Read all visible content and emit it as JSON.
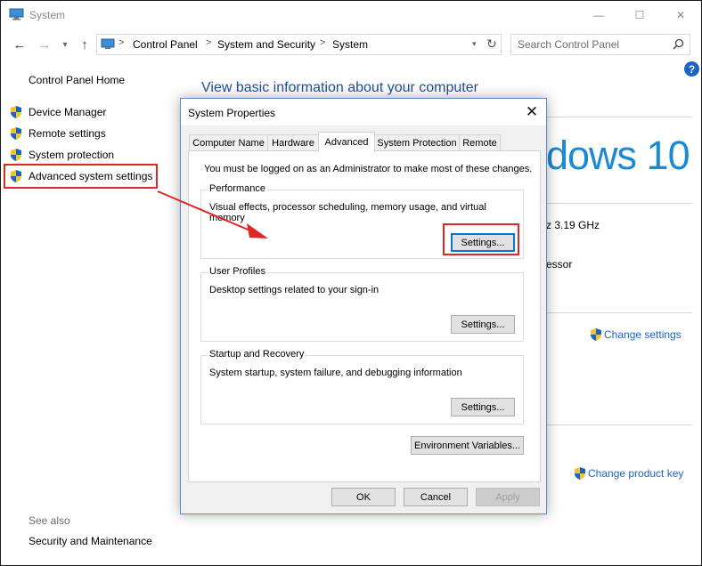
{
  "window": {
    "title": "System"
  },
  "titlebar": {
    "minimize": "—",
    "maximize": "☐",
    "close": "✕"
  },
  "address": {
    "crumbs": [
      "Control Panel",
      "System and Security",
      "System"
    ],
    "separator": ">"
  },
  "search": {
    "placeholder": "Search Control Panel"
  },
  "help": {
    "label": "?"
  },
  "left_pane": {
    "home": "Control Panel Home",
    "items": [
      {
        "label": "Device Manager"
      },
      {
        "label": "Remote settings"
      },
      {
        "label": "System protection"
      },
      {
        "label": "Advanced system settings"
      }
    ],
    "see_also": "See also",
    "see_also_items": [
      {
        "label": "Security and Maintenance"
      }
    ]
  },
  "main": {
    "heading": "View basic information about your computer",
    "windows_logo_text": "dows 10",
    "processor_speed": "z  3.19 GHz",
    "processor_type": "essor",
    "change_settings": "Change settings",
    "change_product_key": "Change product key"
  },
  "dialog": {
    "title": "System Properties",
    "close": "✕",
    "tabs": [
      {
        "label": "Computer Name"
      },
      {
        "label": "Hardware"
      },
      {
        "label": "Advanced",
        "active": true
      },
      {
        "label": "System Protection"
      },
      {
        "label": "Remote"
      }
    ],
    "admin_note": "You must be logged on as an Administrator to make most of these changes.",
    "performance": {
      "legend": "Performance",
      "desc": "Visual effects, processor scheduling, memory usage, and virtual memory",
      "button": "Settings..."
    },
    "user_profiles": {
      "legend": "User Profiles",
      "desc": "Desktop settings related to your sign-in",
      "button": "Settings..."
    },
    "startup_recovery": {
      "legend": "Startup and Recovery",
      "desc": "System startup, system failure, and debugging information",
      "button": "Settings..."
    },
    "env_button": "Environment Variables...",
    "ok": "OK",
    "cancel": "Cancel",
    "apply": "Apply"
  },
  "colors": {
    "highlight": "#e02727",
    "link": "#1a64c8",
    "win10": "#1a8ad4",
    "heading": "#1e4e9c"
  }
}
